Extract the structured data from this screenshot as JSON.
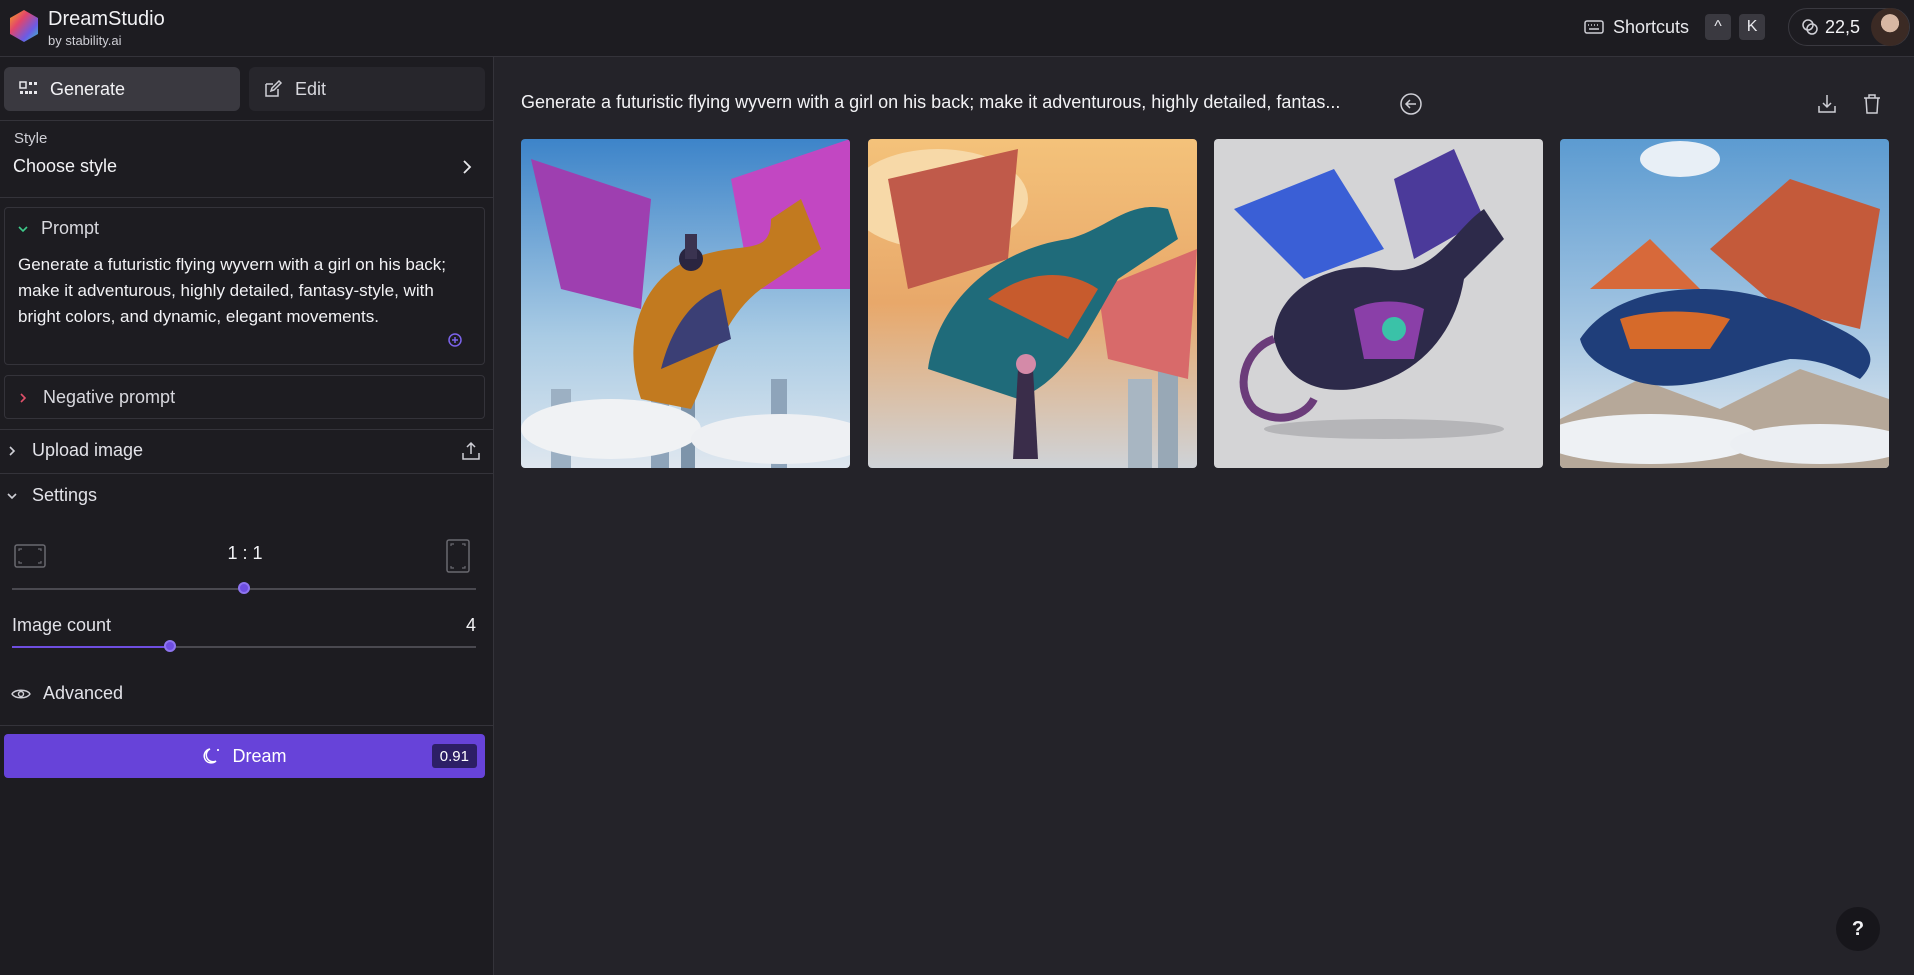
{
  "header": {
    "brand_title": "DreamStudio",
    "brand_sub": "by stability.ai",
    "shortcuts_label": "Shortcuts",
    "key1": "^",
    "key2": "K",
    "credits": "22,5"
  },
  "sidebar": {
    "tabs": [
      {
        "label": "Generate",
        "icon": "grid-icon",
        "active": true
      },
      {
        "label": "Edit",
        "icon": "edit-icon",
        "active": false
      }
    ],
    "style_label": "Style",
    "style_value": "Choose style",
    "prompt_label": "Prompt",
    "prompt_text": "Generate a futuristic flying wyvern with a girl on his back; make it adventurous, highly detailed, fantasy-style, with bright colors, and dynamic, elegant movements.",
    "negative_label": "Negative prompt",
    "upload_label": "Upload image",
    "settings_label": "Settings",
    "aspect_ratio": "1 : 1",
    "aspect_slider_fraction": 0.5,
    "image_count_label": "Image count",
    "image_count": "4",
    "image_count_fraction": 0.34,
    "advanced_label": "Advanced",
    "dream_label": "Dream",
    "dream_cost": "0.91"
  },
  "main": {
    "title": "Generate a futuristic flying wyvern with a girl on his back; make it adventurous, highly detailed, fantas...",
    "images": [
      {
        "name": "wyvern-image-1",
        "subject": "orange-purple wyvern with rider over city"
      },
      {
        "name": "wyvern-image-2",
        "subject": "red-teal dragon with girl in clouds"
      },
      {
        "name": "wyvern-image-3",
        "subject": "blue-purple dragon on grey background"
      },
      {
        "name": "wyvern-image-4",
        "subject": "orange-blue dragon flying in sky"
      }
    ],
    "help": "?"
  },
  "colors": {
    "accent": "#6743d9",
    "background": "#242329",
    "sidebar": "#1d1c21"
  }
}
